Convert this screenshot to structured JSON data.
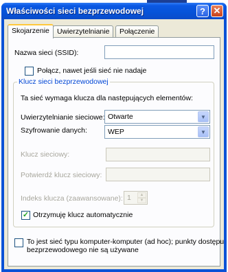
{
  "window": {
    "title": "Właściwości sieci bezprzewodowej",
    "help_label": "?",
    "close_label": "✕"
  },
  "tabs": [
    {
      "label": "Skojarzenie",
      "active": true
    },
    {
      "label": "Uwierzytelnianie",
      "active": false
    },
    {
      "label": "Połączenie",
      "active": false
    }
  ],
  "association": {
    "ssid_label": "Nazwa sieci (SSID):",
    "ssid_value": "",
    "broadcast_checkbox_label": "Połącz, nawet jeśli sieć nie nadaje",
    "broadcast_checked": false,
    "key_group_title": "Klucz sieci bezprzewodowej",
    "key_requirement_text": "Ta sieć wymaga klucza dla następujących elementów:",
    "auth_label": "Uwierzytelnianie sieciowe:",
    "auth_value": "Otwarte",
    "encryption_label": "Szyfrowanie danych:",
    "encryption_value": "WEP",
    "network_key_label": "Klucz sieciowy:",
    "confirm_key_label": "Potwierdź klucz sieciowy:",
    "key_index_label": "Indeks klucza (zaawansowane):",
    "key_index_value": "1",
    "auto_key_label": "Otrzymuję klucz automatycznie",
    "auto_key_checked": true,
    "adhoc_label_line1": "To jest sieć typu komputer-komputer (ad hoc); punkty dostępu",
    "adhoc_label_line2": "bezprzewodowego nie są używane",
    "adhoc_checked": false
  },
  "colors": {
    "titlebar": "#0653d8",
    "dialog_bg": "#ece9d8",
    "panel_bg": "#fcfcfe",
    "group_title": "#0046d5",
    "disabled_text": "#a7a69c",
    "check_mark": "#21a121"
  },
  "icons": {
    "help": "help-button-icon",
    "close": "close-icon",
    "dropdown": "chevron-down-icon",
    "check": "checkmark-icon"
  }
}
